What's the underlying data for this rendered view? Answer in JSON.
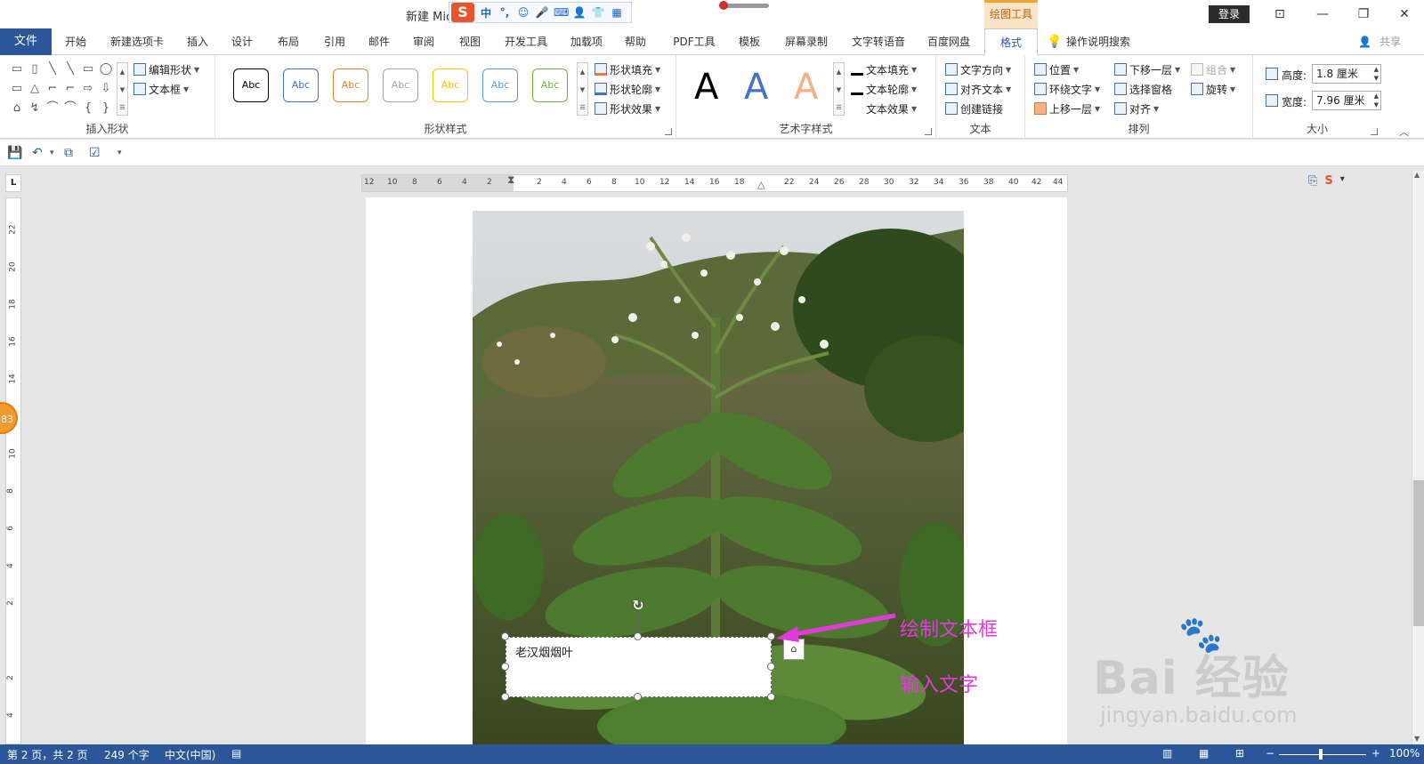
{
  "titlebar": {
    "doc_title": "新建 Mic",
    "ime": {
      "logo": "S",
      "items": [
        "中",
        "°,",
        "☺",
        "🎤",
        "⌨",
        "👤",
        "👕",
        "▦"
      ]
    },
    "context_tab_title": "绘图工具",
    "login": "登录",
    "window_controls": [
      "⊡",
      "—",
      "❐",
      "✕"
    ]
  },
  "tabs": {
    "file": "文件",
    "items": [
      "开始",
      "新建选项卡",
      "插入",
      "设计",
      "布局",
      "引用",
      "邮件",
      "审阅",
      "视图",
      "开发工具",
      "加载项",
      "帮助",
      "PDF工具",
      "模板",
      "屏幕录制",
      "文字转语音",
      "百度网盘",
      "格式"
    ],
    "tell_me": "操作说明搜索",
    "share": "共享"
  },
  "ribbon": {
    "insert_shapes": {
      "label": "插入形状",
      "edit_shape": "编辑形状",
      "textbox": "文本框",
      "shapes": [
        "▭",
        "▯",
        "╲",
        "╲",
        "▭",
        "◯",
        "▭",
        "△",
        "⌐",
        "⌐",
        "⇨",
        "⇩",
        "⌂",
        "↯",
        "⌒",
        "⌒",
        "{",
        "}"
      ]
    },
    "shape_styles": {
      "label": "形状样式",
      "presets": [
        "Abc",
        "Abc",
        "Abc",
        "Abc",
        "Abc",
        "Abc",
        "Abc"
      ],
      "preset_colors": [
        "#000000",
        "#4472c4",
        "#ed7d31",
        "#a5a5a5",
        "#ffc000",
        "#5b9bd5",
        "#70ad47"
      ],
      "fill": "形状填充",
      "outline": "形状轮廓",
      "effects": "形状效果"
    },
    "wordart": {
      "label": "艺术字样式",
      "letters": [
        "A",
        "A",
        "A"
      ],
      "letter_colors": [
        "#000000",
        "#4472c4",
        "#f4b183"
      ],
      "text_fill": "文本填充",
      "text_outline": "文本轮廓",
      "text_effects": "文本效果"
    },
    "text": {
      "label": "文本",
      "direction": "文字方向",
      "align_text": "对齐文本",
      "create_link": "创建链接"
    },
    "arrange": {
      "label": "排列",
      "position": "位置",
      "wrap_text": "环绕文字",
      "bring_forward": "上移一层",
      "send_backward": "下移一层",
      "selection_pane": "选择窗格",
      "align": "对齐",
      "group": "组合",
      "rotate": "旋转"
    },
    "size": {
      "label": "大小",
      "height_label": "高度:",
      "height_value": "1.8 厘米",
      "width_label": "宽度:",
      "width_value": "7.96 厘米"
    }
  },
  "qat": {
    "icons": [
      "💾",
      "↶",
      "▾",
      "⧉",
      "☑",
      "▾"
    ]
  },
  "ruler": {
    "corner": "L",
    "h_ticks": [
      "12",
      "10",
      "8",
      "6",
      "4",
      "2",
      "2",
      "4",
      "6",
      "8",
      "10",
      "12",
      "14",
      "16",
      "18",
      "22",
      "24",
      "26",
      "28",
      "30",
      "32",
      "34",
      "36",
      "38",
      "40",
      "42",
      "44"
    ],
    "v_ticks": [
      "22",
      "20",
      "18",
      "16",
      "14",
      "12",
      "10",
      "8",
      "6",
      "4",
      "2",
      "2",
      "4"
    ]
  },
  "document": {
    "textbox_text": "老汉烟烟叶",
    "layout_options_icon": "⌂",
    "annotation_1": "绘制文本框",
    "annotation_2": "输入文字",
    "side_badge": "83",
    "watermark_main": "Bai 经验",
    "watermark_sub": "jingyan.baidu.com"
  },
  "statusbar": {
    "page": "第 2 页，共 2 页",
    "words": "249 个字",
    "language": "中文(中国)",
    "zoom_minus": "−",
    "zoom_plus": "+",
    "zoom": "100%"
  }
}
